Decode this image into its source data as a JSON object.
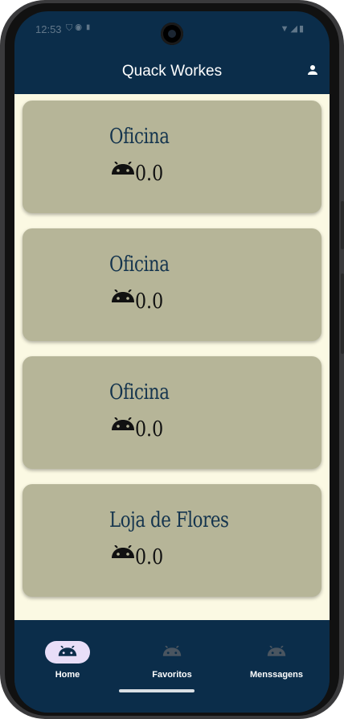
{
  "status_bar": {
    "time": "12:53",
    "left_icons": [
      "shield-icon",
      "badge-icon",
      "sd-card-icon"
    ],
    "right_icons": [
      "wifi-icon",
      "signal-icon",
      "battery-icon"
    ]
  },
  "app_bar": {
    "title": "Quack Workes",
    "profile_icon": "person-icon"
  },
  "cards": [
    {
      "title": "Oficina",
      "rating": "0.0",
      "icon": "android-icon"
    },
    {
      "title": "Oficina",
      "rating": "0.0",
      "icon": "android-icon"
    },
    {
      "title": "Oficina",
      "rating": "0.0",
      "icon": "android-icon"
    },
    {
      "title": "Loja de Flores",
      "rating": "0.0",
      "icon": "android-icon"
    }
  ],
  "nav": {
    "items": [
      {
        "label": "Home",
        "icon": "android-icon",
        "active": true
      },
      {
        "label": "Favoritos",
        "icon": "android-icon",
        "active": false
      },
      {
        "label": "Menssagens",
        "icon": "android-icon",
        "active": false
      }
    ]
  },
  "colors": {
    "primary_dark": "#0b2d4a",
    "background": "#fbf9e3",
    "card": "#b6b598",
    "card_title": "#14344e",
    "nav_active_pill": "#e8def8"
  }
}
